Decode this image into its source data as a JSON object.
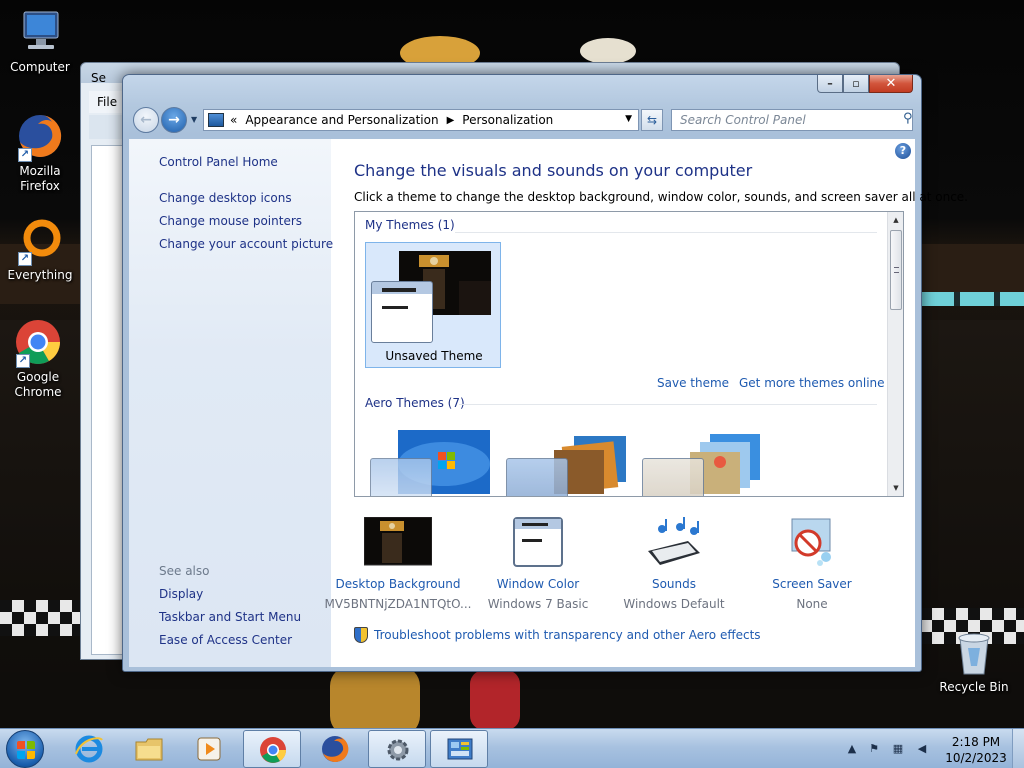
{
  "desktop": {
    "icons": [
      {
        "label": "Computer"
      },
      {
        "label": "Mozilla Firefox"
      },
      {
        "label": "Everything"
      },
      {
        "label": "Google Chrome"
      },
      {
        "label": "Recycle Bin"
      }
    ]
  },
  "back_window": {
    "title": "Se",
    "menu_file": "File"
  },
  "window": {
    "controls": {
      "minimize": "–",
      "maximize": "▫",
      "close": "✕"
    },
    "address": {
      "prefix": "«",
      "crumbs": [
        "Appearance and Personalization",
        "Personalization"
      ]
    },
    "search": {
      "placeholder": "Search Control Panel"
    },
    "left_pane": {
      "home": "Control Panel Home",
      "links": [
        "Change desktop icons",
        "Change mouse pointers",
        "Change your account picture"
      ],
      "see_also_label": "See also",
      "see_also": [
        "Display",
        "Taskbar and Start Menu",
        "Ease of Access Center"
      ]
    },
    "main": {
      "title": "Change the visuals and sounds on your computer",
      "description": "Click a theme to change the desktop background, window color, sounds, and screen saver all at once.",
      "my_themes_header": "My Themes (1)",
      "my_theme_name": "Unsaved Theme",
      "save_theme": "Save theme",
      "get_more": "Get more themes online",
      "aero_themes_header": "Aero Themes (7)",
      "bottom": [
        {
          "label": "Desktop Background",
          "sub": "MV5BNTNjZDA1NTQtO..."
        },
        {
          "label": "Window Color",
          "sub": "Windows 7 Basic"
        },
        {
          "label": "Sounds",
          "sub": "Windows Default"
        },
        {
          "label": "Screen Saver",
          "sub": "None"
        }
      ],
      "troubleshoot": "Troubleshoot problems with transparency and other Aero effects"
    }
  },
  "taskbar": {
    "clock_time": "2:18 PM",
    "clock_date": "10/2/2023"
  },
  "colors": {
    "link": "#1e5ab0",
    "heading": "#1e3287",
    "taskbar": "#a8c2e0"
  }
}
